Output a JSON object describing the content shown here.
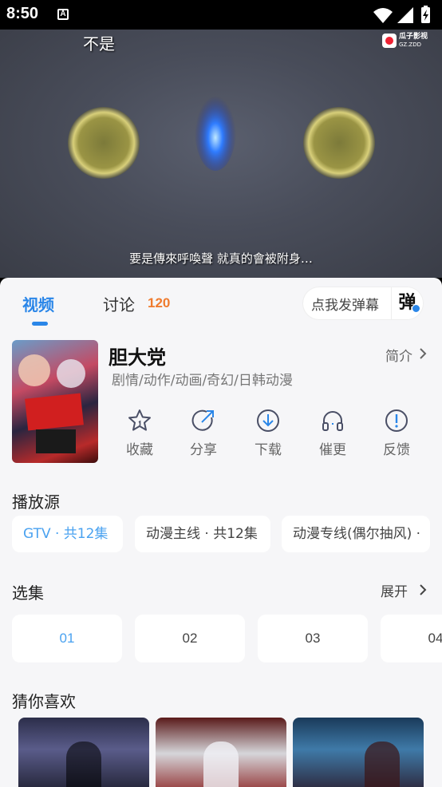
{
  "status_bar": {
    "time": "8:50",
    "notification_glyph": "A",
    "icons": [
      "wifi-icon",
      "signal-icon",
      "battery-charging-icon"
    ]
  },
  "video": {
    "top_subtitle": "不是",
    "subtitle": "要是傳來呼喚聲 就真的會被附身…",
    "watermark_name": "瓜子影视",
    "watermark_sub": "GZ.ZDD"
  },
  "tabs": {
    "video": "视频",
    "discussion": "讨论",
    "discussion_count": "120"
  },
  "danmu": {
    "placeholder": "点我发弹幕",
    "button": "弹"
  },
  "show": {
    "title": "胆大党",
    "genres": "剧情/动作/动画/奇幻/日韩动漫",
    "intro": "简介"
  },
  "actions": [
    {
      "label": "收藏",
      "icon": "star-icon"
    },
    {
      "label": "分享",
      "icon": "share-icon"
    },
    {
      "label": "下载",
      "icon": "download-icon"
    },
    {
      "label": "催更",
      "icon": "headphones-icon"
    },
    {
      "label": "反馈",
      "icon": "feedback-icon"
    }
  ],
  "sources": {
    "title": "播放源",
    "items": [
      {
        "label": "GTV · 共12集"
      },
      {
        "label": "动漫主线 · 共12集"
      },
      {
        "label": "动漫专线(偶尔抽风) ·"
      }
    ]
  },
  "episodes": {
    "title": "选集",
    "expand": "展开",
    "items": [
      "01",
      "02",
      "03",
      "04"
    ]
  },
  "recommend": {
    "title": "猜你喜欢"
  },
  "colors": {
    "accent": "#2a86e8",
    "count": "#ef7b2e",
    "sheet_bg": "#f6f6f8"
  }
}
